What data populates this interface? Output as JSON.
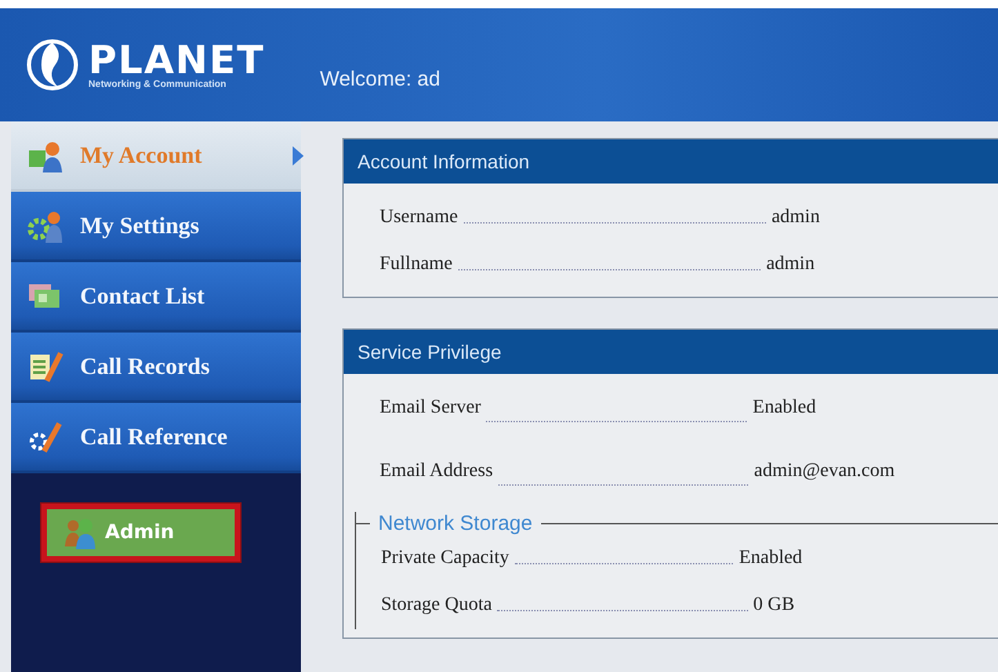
{
  "header": {
    "logo_text": "PLANET",
    "logo_tagline": "Networking & Communication",
    "welcome": "Welcome: ad"
  },
  "sidebar": {
    "items": [
      {
        "label": "My Account",
        "selected": true,
        "kind": "account"
      },
      {
        "label": "My Settings",
        "selected": false,
        "kind": "settings"
      },
      {
        "label": "Contact List",
        "selected": false,
        "kind": "contacts"
      },
      {
        "label": "Call Records",
        "selected": false,
        "kind": "records"
      },
      {
        "label": "Call Reference",
        "selected": false,
        "kind": "reference"
      }
    ],
    "admin_button": "Admin"
  },
  "panels": [
    {
      "title": "Account Information",
      "rows": [
        {
          "label": "Username",
          "value": "admin"
        },
        {
          "label": "Fullname",
          "value": "admin"
        }
      ]
    },
    {
      "title": "Service Privilege",
      "rows": [
        {
          "label": "Email Server",
          "value": "Enabled"
        },
        {
          "label": "Email Address",
          "value": "admin@evan.com"
        }
      ],
      "group": {
        "title": "Network Storage",
        "rows": [
          {
            "label": "Private Capacity",
            "value": "Enabled"
          },
          {
            "label": "Storage Quota",
            "value": "0 GB"
          }
        ]
      }
    }
  ]
}
